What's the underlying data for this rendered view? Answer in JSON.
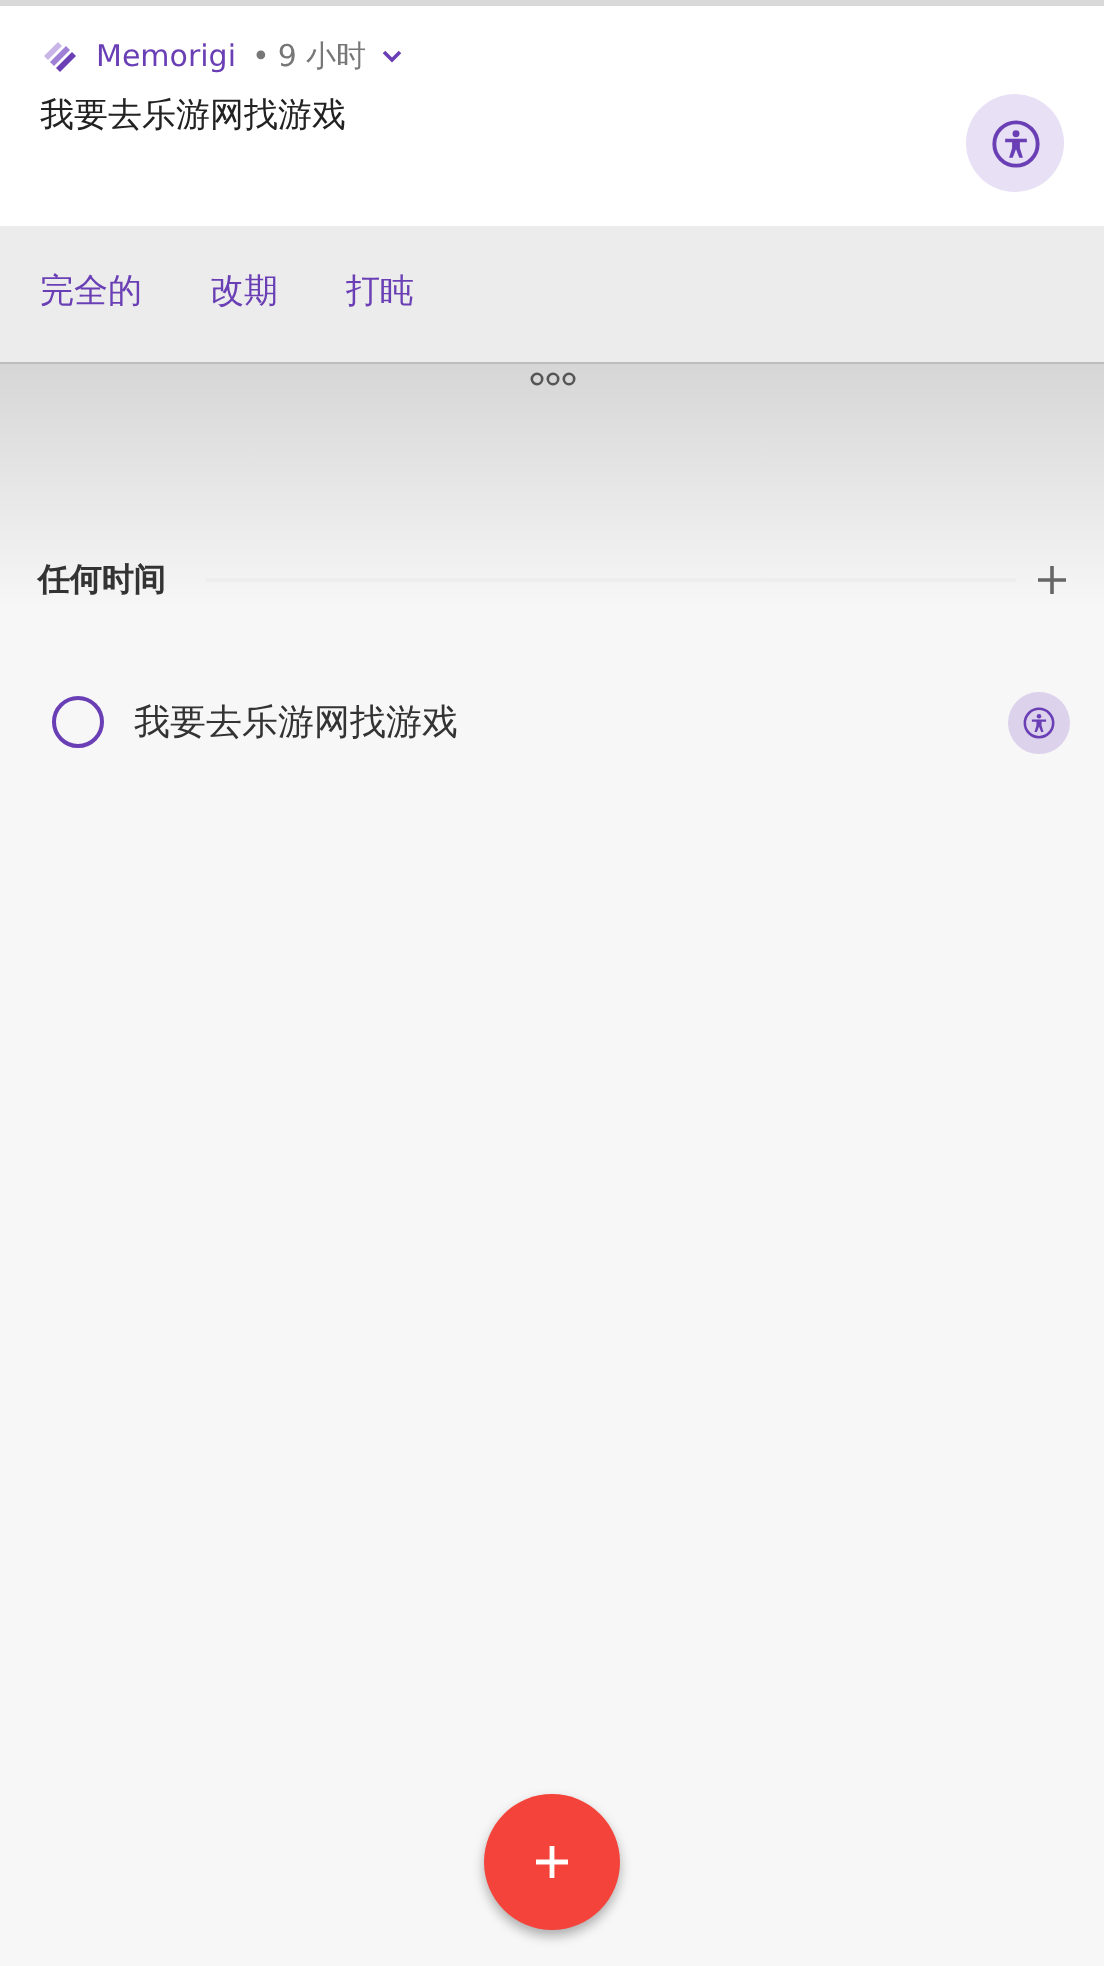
{
  "notification": {
    "app_name": "Memorigi",
    "separator": "•",
    "time": "9 小时",
    "title": "我要去乐游网找游戏",
    "actions": [
      "完全的",
      "改期",
      "打盹"
    ]
  },
  "section": {
    "title": "任何时间"
  },
  "tasks": [
    {
      "title": "我要去乐游网找游戏",
      "checked": false
    }
  ]
}
